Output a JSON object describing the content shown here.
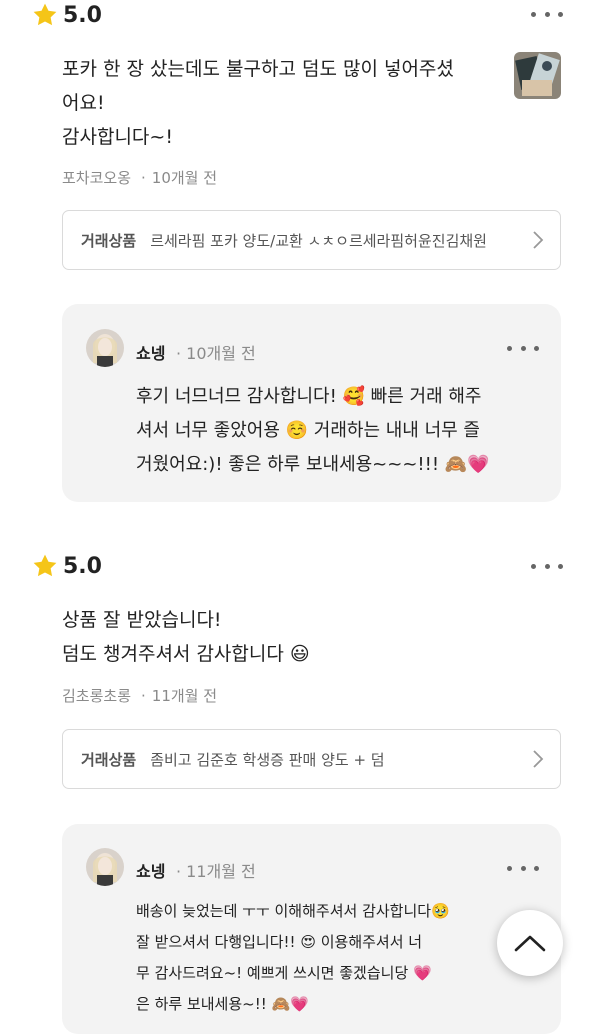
{
  "reviews": [
    {
      "rating": "5.0",
      "text": "포카 한 장 샀는데도 불구하고 덤도 많이 넣어주셨\n어요!\n감사합니다~!",
      "author": "포차코오옹",
      "time": "10개월 전",
      "trade_label": "거래상품",
      "trade_item": "르세라핌 포카 양도/교환 ㅅㅊㅇ르세라핌허윤진김채원",
      "reply": {
        "name": "쇼넹",
        "time": "10개월 전",
        "text": "후기 너므너므 감사합니다! 🥰 빠른 거래 해주\n셔서 너무 좋았어용 ☺️ 거래하는 내내 너무 즐\n거웠어요:)! 좋은 하루 보내세용~~~!!! 🙈💗"
      }
    },
    {
      "rating": "5.0",
      "text": "상품 잘 받았습니다!\n덤도 챙겨주셔서 감사합니다 😃",
      "author": "김초롱초롱",
      "time": "11개월 전",
      "trade_label": "거래상품",
      "trade_item": "좀비고 김준호 학생증 판매 양도 + 덤",
      "reply": {
        "name": "쇼넹",
        "time": "11개월 전",
        "text": "배송이 늦었는데 ㅜㅜ 이해해주셔서 감사합니다🥹\n잘 받으셔서 다행입니다!! 😍     이용해주셔서 너\n무 감사드려요~! 예쁘게 쓰시면 좋겠습니당 💗\n은 하루 보내세용~!! 🙈💗"
      }
    }
  ],
  "colors": {
    "star": "#f5c518",
    "reply_bg": "#f3f3f3",
    "meta": "#8a8a8a"
  },
  "icons": {
    "star": "star-icon",
    "more": "more-dots-icon",
    "chevron": "chevron-right-icon",
    "scroll_top": "chevron-up-icon"
  }
}
